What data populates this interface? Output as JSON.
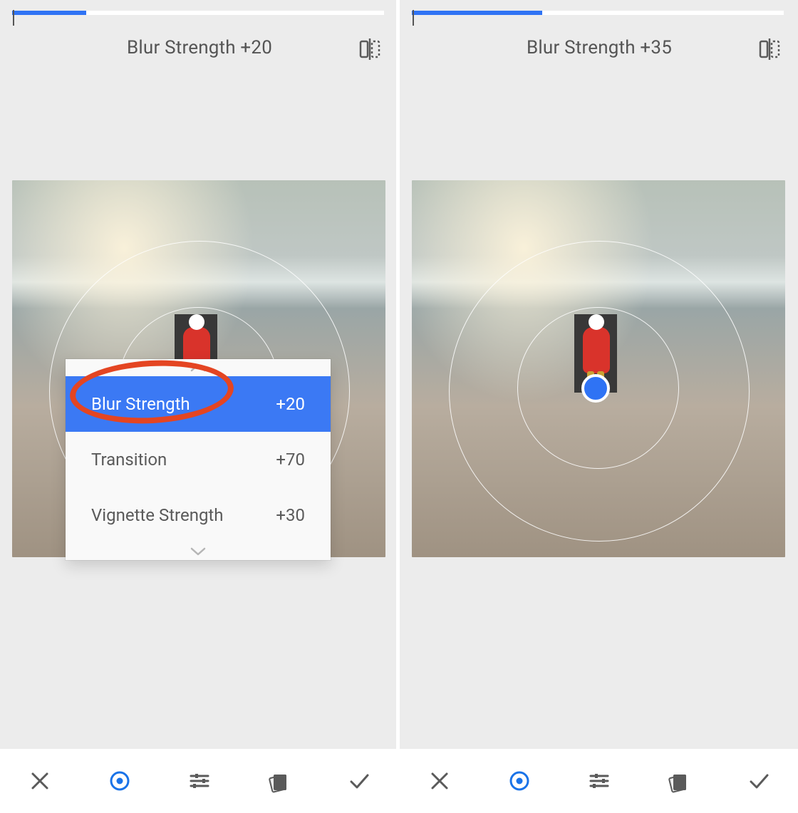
{
  "left": {
    "progress_percent": 20,
    "header": "Blur Strength +20",
    "menu": {
      "items": [
        {
          "label": "Blur Strength",
          "value": "+20",
          "selected": true
        },
        {
          "label": "Transition",
          "value": "+70",
          "selected": false
        },
        {
          "label": "Vignette Strength",
          "value": "+30",
          "selected": false
        }
      ]
    }
  },
  "right": {
    "progress_percent": 35,
    "header": "Blur Strength +35"
  },
  "toolbar": {
    "cancel": "Cancel",
    "focus": "Focus shape",
    "adjust": "Adjust",
    "styles": "Styles",
    "apply": "Apply"
  },
  "icons": {
    "compare": "compare-icon",
    "cancel": "close-icon",
    "focus": "focus-circle-icon",
    "adjust": "sliders-icon",
    "styles": "card-stack-icon",
    "apply": "check-icon",
    "chev_up": "chevron-up-icon",
    "chev_down": "chevron-down-icon"
  },
  "annotation_color": "#E44522"
}
